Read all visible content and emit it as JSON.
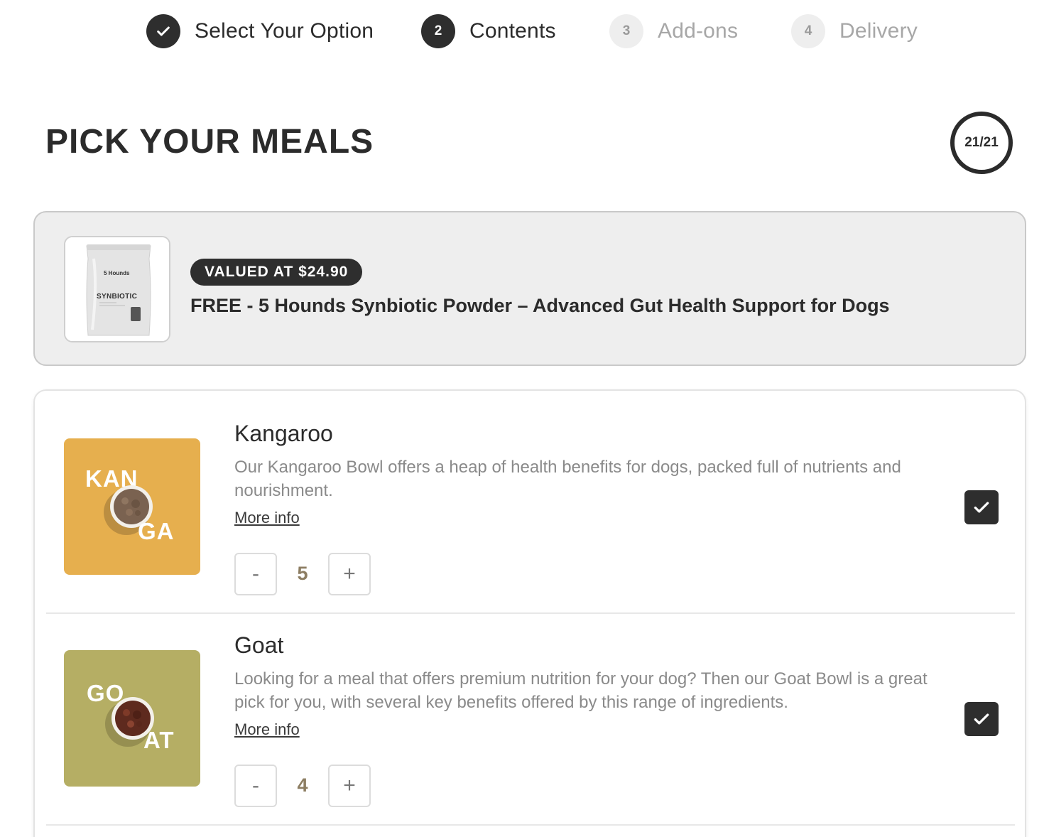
{
  "stepper": {
    "steps": [
      {
        "number": "✓",
        "label": "Select Your Option",
        "state": "done"
      },
      {
        "number": "2",
        "label": "Contents",
        "state": "active"
      },
      {
        "number": "3",
        "label": "Add-ons",
        "state": "pending"
      },
      {
        "number": "4",
        "label": "Delivery",
        "state": "pending"
      }
    ]
  },
  "header": {
    "title": "PICK YOUR MEALS",
    "counter": "21/21"
  },
  "promo": {
    "badge": "VALUED AT $24.90",
    "title": "FREE - 5 Hounds Synbiotic Powder – Advanced Gut Health Support for Dogs",
    "package_brand": "5 Hounds",
    "package_label": "SYNBIOTIC"
  },
  "meals": [
    {
      "name": "Kangaroo",
      "description": "Our Kangaroo Bowl offers a heap of health benefits for dogs, packed full of nutrients and nourishment.",
      "more_info": "More info",
      "quantity": "5",
      "decrement": "-",
      "increment": "+",
      "image_text_top": "KAN",
      "image_text_bottom": "GA",
      "image_color": "#E6AF4E",
      "selected": true
    },
    {
      "name": "Goat",
      "description": "Looking for a meal that offers premium nutrition for your dog? Then our Goat Bowl is a great pick for you, with several key benefits offered by this range of ingredients.",
      "more_info": "More info",
      "quantity": "4",
      "decrement": "-",
      "increment": "+",
      "image_text_top": "GO",
      "image_text_bottom": "AT",
      "image_color": "#B5AE64",
      "selected": true
    }
  ],
  "colors": {
    "dark": "#2E2E2E",
    "muted": "#A7A7A7",
    "promo_bg": "#EEEEEE",
    "quantity": "#8D7E63"
  },
  "icons": {
    "check": "check-icon",
    "checkbox": "checkbox-checked-icon"
  }
}
